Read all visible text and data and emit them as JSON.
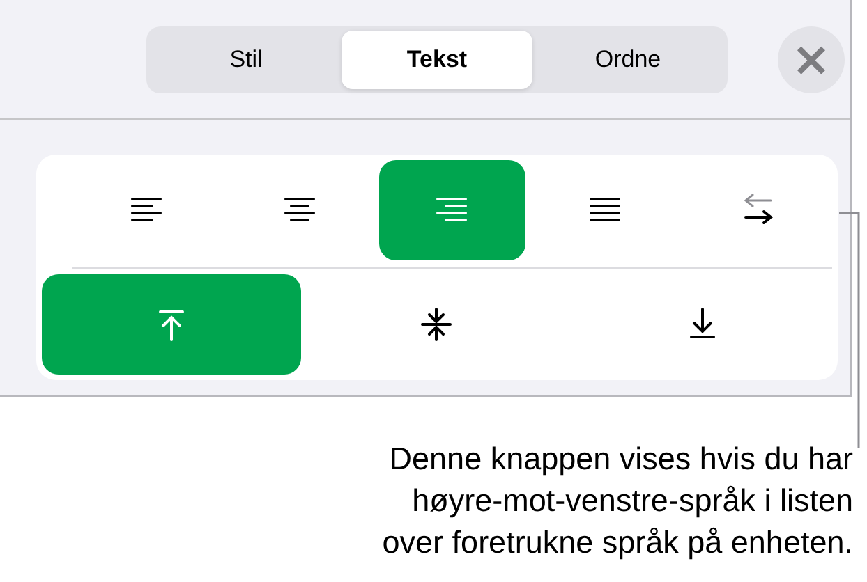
{
  "tabs": [
    {
      "label": "Stil",
      "selected": false
    },
    {
      "label": "Tekst",
      "selected": true
    },
    {
      "label": "Ordne",
      "selected": false
    }
  ],
  "close_button": {
    "label": "×"
  },
  "alignment_buttons": [
    {
      "kind": "left",
      "selected": false
    },
    {
      "kind": "center",
      "selected": false
    },
    {
      "kind": "right",
      "selected": true
    },
    {
      "kind": "justify",
      "selected": false
    },
    {
      "kind": "direction",
      "selected": false
    }
  ],
  "vertical_buttons": [
    {
      "kind": "top",
      "selected": true
    },
    {
      "kind": "middle",
      "selected": false
    },
    {
      "kind": "bottom",
      "selected": false
    }
  ],
  "callout": {
    "text": "Denne knappen vises hvis du har\nhøyre-mot-venstre-språk i listen\nover foretrukne språk på enheten."
  }
}
